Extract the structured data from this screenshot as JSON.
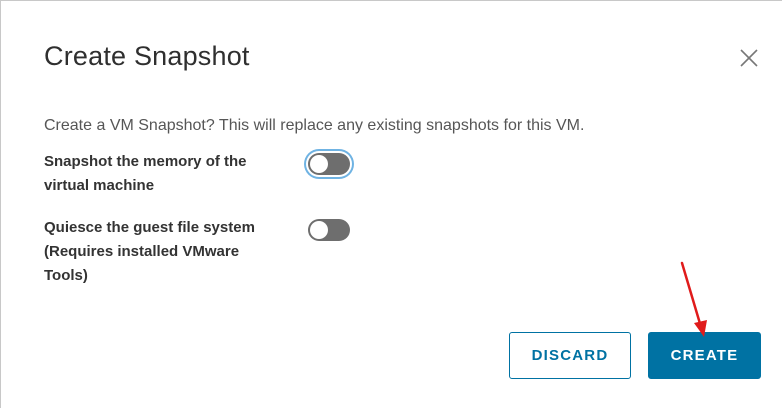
{
  "dialog": {
    "title": "Create Snapshot",
    "close_icon": "close-icon",
    "description": "Create a VM Snapshot? This will replace any existing snapshots for this VM.",
    "options": [
      {
        "label_line1": "Snapshot the memory of the",
        "label_line2": "virtual machine",
        "enabled": false
      },
      {
        "label_line1": "Quiesce the guest file system",
        "label_line2": "(Requires installed VMware",
        "label_line3": "Tools)",
        "enabled": false
      }
    ],
    "buttons": {
      "discard": "DISCARD",
      "create": "CREATE"
    }
  },
  "colors": {
    "primary": "#0072a3",
    "toggle_off": "#6e6e6e",
    "annotation_arrow": "#e01b1b"
  }
}
